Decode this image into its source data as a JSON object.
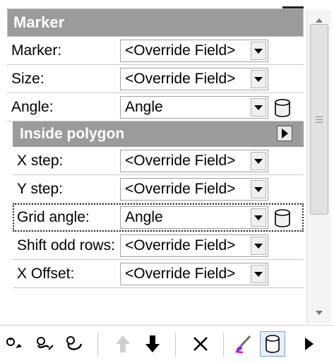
{
  "section": {
    "title": "Marker"
  },
  "marker_rows": [
    {
      "label": "Marker:",
      "value": "<Override Field>"
    },
    {
      "label": "Size:",
      "value": "<Override Field>"
    },
    {
      "label": "Angle:",
      "value": "Angle"
    }
  ],
  "subsection": {
    "title": "Inside polygon"
  },
  "inside_rows": [
    {
      "label": "X step:",
      "value": "<Override Field>"
    },
    {
      "label": "Y step:",
      "value": "<Override Field>"
    },
    {
      "label": "Grid angle:",
      "value": "Angle"
    },
    {
      "label": "Shift odd rows:",
      "value": "<Override Field>"
    },
    {
      "label": "X Offset:",
      "value": "<Override Field>"
    }
  ],
  "icons": {
    "database": "database-icon",
    "toolbar": [
      "add-symbol-icon",
      "add-symbol-variant-icon",
      "remove-symbol-icon",
      "move-up-icon",
      "move-down-icon",
      "delete-icon",
      "brush-icon",
      "database-icon",
      "play-icon"
    ]
  },
  "colors": {
    "header_bg": "#9b9b9b",
    "header_text": "#ffffff",
    "pressed_border": "#7d9fd0"
  }
}
